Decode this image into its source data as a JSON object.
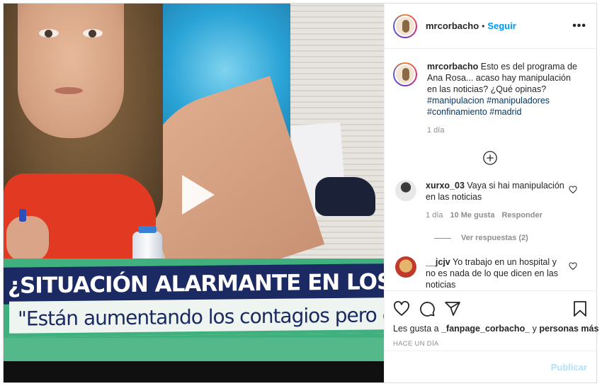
{
  "post": {
    "username": "mrcorbacho",
    "follow_label": "Seguir",
    "dot": "•",
    "more_icon": "more-options-icon",
    "more_glyph": "•••",
    "video": {
      "headline": "¿SITUACIÓN ALARMANTE EN LOS HOSPITALES MA",
      "subline": "\"Están aumentando los contagios pero con unos p",
      "play_icon": "play-icon"
    },
    "caption": {
      "username": "mrcorbacho",
      "text": "Esto es del programa de Ana Rosa... acaso hay manipulación en las noticias? ¿Qué opinas?",
      "hashtags": [
        "#manipulacion",
        "#manipuladores",
        "#confinamiento",
        "#madrid"
      ],
      "time": "1 día"
    },
    "load_more_icon": "plus-circle-icon",
    "comments": [
      {
        "username": "xurxo_03",
        "text": "Vaya si hai manipulación en las noticias",
        "time": "1 día",
        "likes": "10 Me gusta",
        "reply_label": "Responder",
        "view_replies": "Ver respuestas (2)"
      },
      {
        "username": "__jcjv",
        "text": "Yo trabajo en un hospital y no es nada de lo que dicen en las noticias"
      }
    ],
    "likes_line": {
      "prefix": "Les gusta a ",
      "user": "_fanpage_corbacho_",
      "middle": " y ",
      "rest": "personas más"
    },
    "timestamp": "HACE UN DÍA",
    "add_comment": {
      "placeholder": "",
      "publish_label": "Publicar"
    }
  },
  "colors": {
    "accent": "#0095f6",
    "hashtag": "#00376b",
    "muted": "#8e8e8e",
    "publish_disabled": "#b2dffc"
  }
}
